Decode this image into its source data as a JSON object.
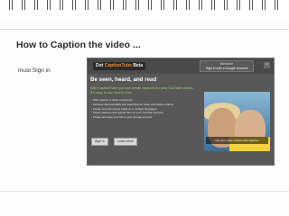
{
  "slide": {
    "title": "How to Caption the video ...",
    "side_note": "must Sign in"
  },
  "screenshot": {
    "logo_prefix": "Dot",
    "logo_accent": "CaptionTube",
    "logo_suffix": "Beta",
    "welcome": "Welcome",
    "sign_in_prompt": "Sign in with a Google Account",
    "close_glyph": "×",
    "headline_prefix": "Be seen, heard, and",
    "headline_strong": "read",
    "lead": "With CaptionTube you can create captions for your YouTube videos. It's easy to use and it's free.",
    "bullets": [
      "Offer viewers a richer experience",
      "Increase discoverability and searching for video and caption effects",
      "Create and edit closed captions in multiple languages",
      "Import captions and upload them to your YouTube account",
      "Create and save your file to your Google account"
    ],
    "buttons": [
      "Sign in",
      "Learn More"
    ],
    "photo_caption": "Get your video noticed with captions"
  },
  "colors": {
    "accent_highlight": "#e8357a",
    "brand_orange": "#f28c28",
    "lead_green": "#9fd36a"
  }
}
